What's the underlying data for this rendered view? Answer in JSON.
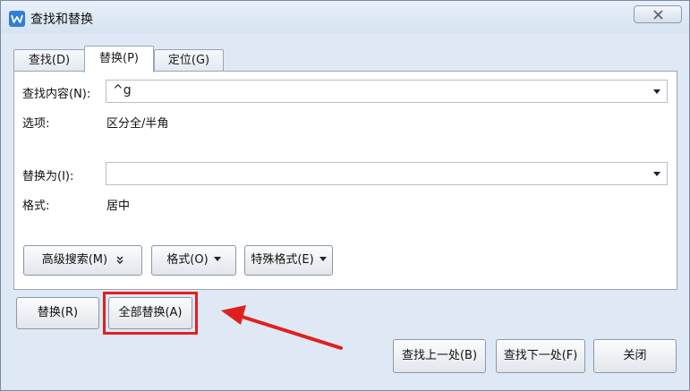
{
  "window": {
    "title": "查找和替换"
  },
  "tabs": [
    {
      "label": "查找(D)"
    },
    {
      "label": "替换(P)"
    },
    {
      "label": "定位(G)"
    }
  ],
  "find": {
    "label": "查找内容(N):",
    "value": "^g"
  },
  "options": {
    "label": "选项:",
    "value": "区分全/半角"
  },
  "replace": {
    "label": "替换为(I):",
    "value": ""
  },
  "format": {
    "label": "格式:",
    "value": "居中"
  },
  "panel_buttons": {
    "advanced": "高级搜索(M)",
    "format": "格式(O)",
    "special": "特殊格式(E)"
  },
  "actions": {
    "replace": "替换(R)",
    "replace_all": "全部替换(A)",
    "find_prev": "查找上一处(B)",
    "find_next": "查找下一处(F)",
    "close": "关闭"
  },
  "colors": {
    "highlight": "#e0201f",
    "app_icon": "#2f7fd6"
  }
}
